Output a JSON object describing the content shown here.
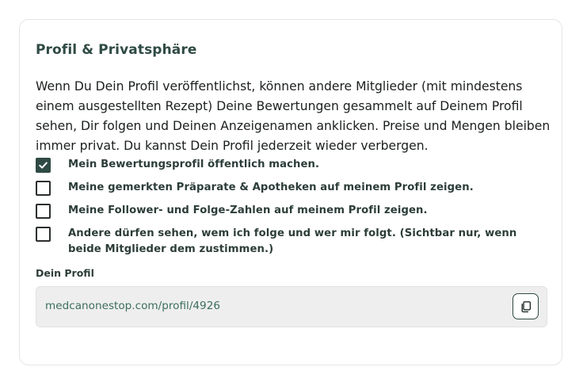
{
  "section": {
    "title": "Profil & Privatsphäre",
    "description": "Wenn Du Dein Profil veröffentlichst, können andere Mitglieder (mit mindestens einem ausgestellten Rezept) Deine Bewertungen gesammelt auf Deinem Profil sehen, Dir folgen und Deinen Anzeigenamen anklicken. Preise und Mengen bleiben immer privat. Du kannst Dein Profil jederzeit wieder verbergen."
  },
  "options": [
    {
      "label": "Mein Bewertungsprofil öffentlich machen.",
      "checked": true
    },
    {
      "label": "Meine gemerkten Präparate & Apotheken auf meinem Profil zeigen.",
      "checked": false
    },
    {
      "label": "Meine Follower- und Folge-Zahlen auf meinem Profil zeigen.",
      "checked": false
    },
    {
      "label": "Andere dürfen sehen, wem ich folge und wer mir folgt. (Sichtbar nur, wenn beide Mitglieder dem zustimmen.)",
      "checked": false
    }
  ],
  "profile": {
    "label": "Dein Profil",
    "url": "medcanonestop.com/profil/4926",
    "copy_icon": "copy-icon"
  },
  "colors": {
    "accent": "#2f4a44",
    "url_text": "#3d6e5f",
    "url_box_bg": "#eeeeee"
  }
}
